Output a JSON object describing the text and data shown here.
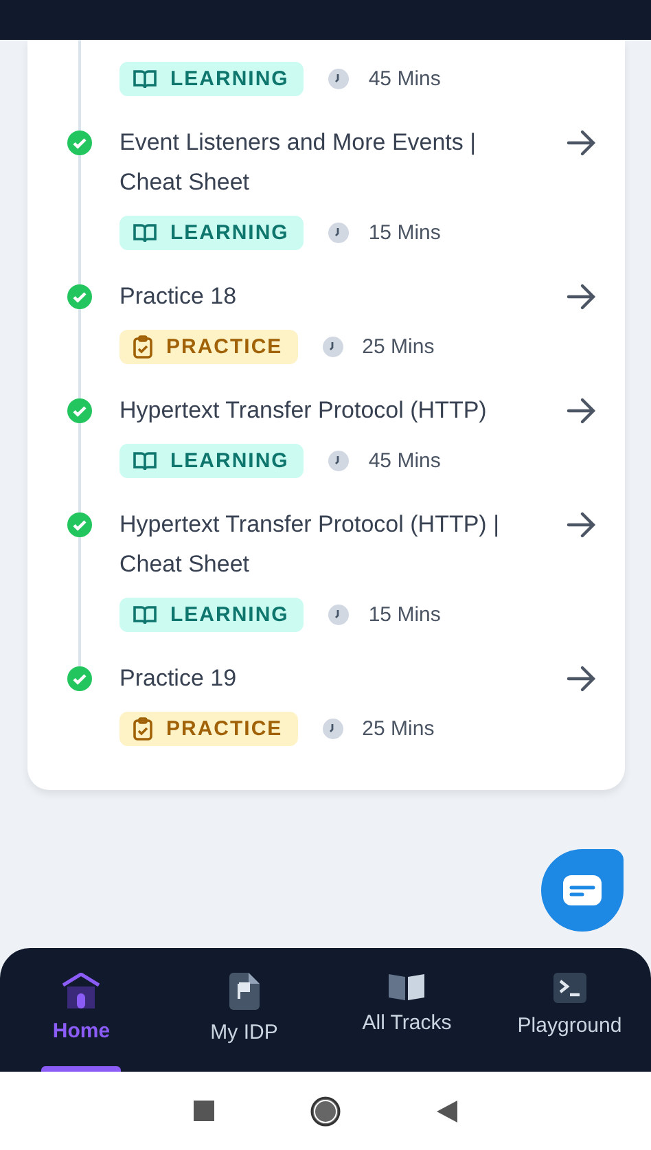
{
  "lessons": [
    {
      "tag": {
        "kind": "learning",
        "label": "LEARNING"
      },
      "duration": "45 Mins"
    },
    {
      "title": "Event Listeners and More Events | Cheat Sheet",
      "completed": true,
      "tag": {
        "kind": "learning",
        "label": "LEARNING"
      },
      "duration": "15 Mins"
    },
    {
      "title": "Practice 18",
      "completed": true,
      "tag": {
        "kind": "practice",
        "label": "PRACTICE"
      },
      "duration": "25 Mins"
    },
    {
      "title": "Hypertext Transfer Protocol (HTTP)",
      "completed": true,
      "tag": {
        "kind": "learning",
        "label": "LEARNING"
      },
      "duration": "45 Mins"
    },
    {
      "title": "Hypertext Transfer Protocol (HTTP) | Cheat Sheet",
      "completed": true,
      "tag": {
        "kind": "learning",
        "label": "LEARNING"
      },
      "duration": "15 Mins"
    },
    {
      "title": "Practice 19",
      "completed": true,
      "tag": {
        "kind": "practice",
        "label": "PRACTICE"
      },
      "duration": "25 Mins"
    }
  ],
  "bottom_nav": [
    {
      "kind": "home",
      "label": "Home",
      "selected": true
    },
    {
      "kind": "idp",
      "label": "My IDP",
      "selected": false
    },
    {
      "kind": "tracks",
      "label": "All Tracks",
      "selected": false
    },
    {
      "kind": "playground",
      "label": "Playground",
      "selected": false
    }
  ]
}
